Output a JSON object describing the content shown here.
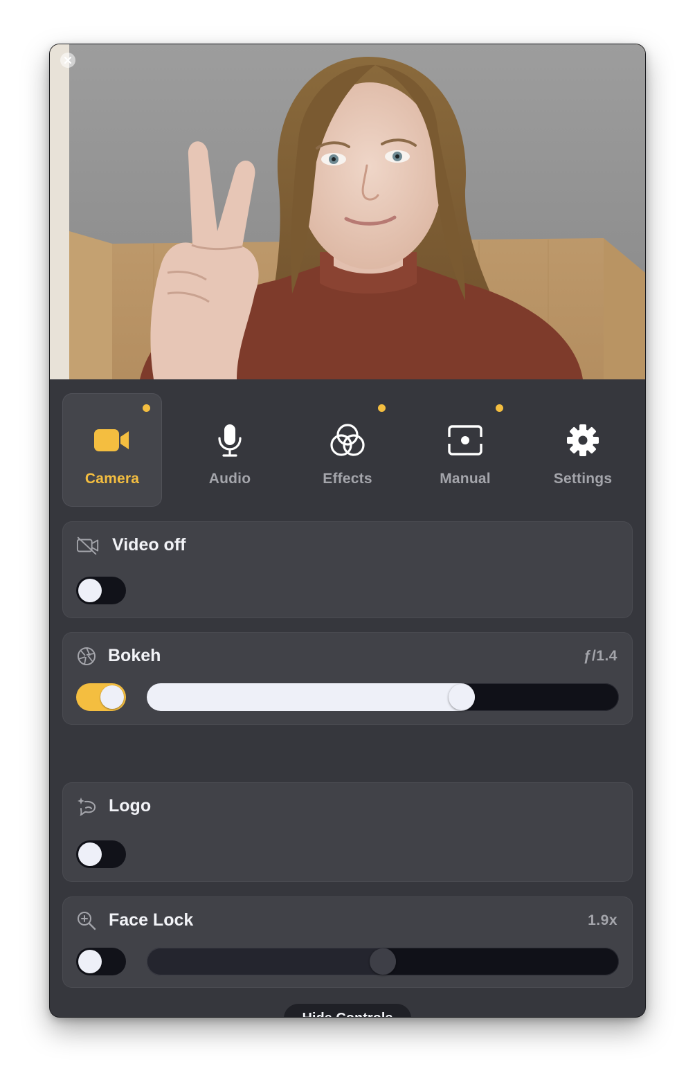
{
  "window": {
    "close_icon": "close-icon"
  },
  "tabs": [
    {
      "id": "camera",
      "label": "Camera",
      "icon": "video-camera-icon",
      "active": true,
      "dot": true
    },
    {
      "id": "audio",
      "label": "Audio",
      "icon": "microphone-icon",
      "active": false,
      "dot": false
    },
    {
      "id": "effects",
      "label": "Effects",
      "icon": "effects-circles-icon",
      "active": false,
      "dot": true
    },
    {
      "id": "manual",
      "label": "Manual",
      "icon": "manual-frame-icon",
      "active": false,
      "dot": true
    },
    {
      "id": "settings",
      "label": "Settings",
      "icon": "gear-icon",
      "active": false,
      "dot": false
    }
  ],
  "cards": {
    "video_off": {
      "title": "Video off",
      "icon": "video-off-icon",
      "enabled": false
    },
    "bokeh": {
      "title": "Bokeh",
      "icon": "aperture-icon",
      "value": "ƒ/1.4",
      "enabled": true,
      "level": 0.667
    },
    "logo": {
      "title": "Logo",
      "icon": "logo-sparkle-icon",
      "enabled": false
    },
    "face_lock": {
      "title": "Face Lock",
      "icon": "zoom-in-icon",
      "value": "1.9x",
      "enabled": false,
      "level": 0.5
    }
  },
  "hide_controls": {
    "label": "Hide Controls"
  },
  "colors": {
    "accent": "#f4be40",
    "panel": "#36373d",
    "card": "#414248",
    "track": "#101118",
    "text": "#f2f3f7",
    "muted": "#a4a5ab"
  }
}
